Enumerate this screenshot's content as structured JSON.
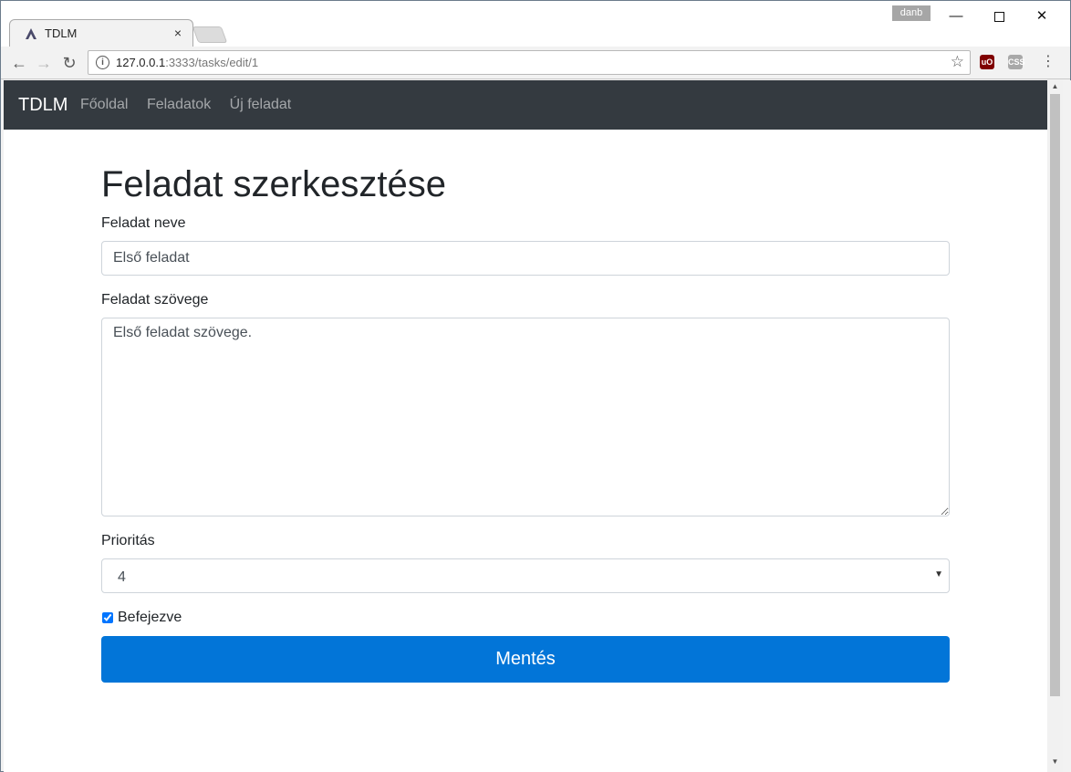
{
  "browser": {
    "tab_title": "TDLM",
    "tab_close": "×",
    "user_badge": "danb",
    "url_host": "127.0.0.1",
    "url_rest": ":3333/tasks/edit/1",
    "ext_ublock": "uO",
    "ext_css": "CSS"
  },
  "navbar": {
    "brand": "TDLM",
    "links": [
      "Főoldal",
      "Feladatok",
      "Új feladat"
    ]
  },
  "form": {
    "heading": "Feladat szerkesztése",
    "name_label": "Feladat neve",
    "name_value": "Első feladat",
    "text_label": "Feladat szövege",
    "text_value": "Első feladat szövege.",
    "priority_label": "Prioritás",
    "priority_value": "4",
    "done_label": "Befejezve",
    "done_checked": true,
    "save_label": "Mentés"
  }
}
